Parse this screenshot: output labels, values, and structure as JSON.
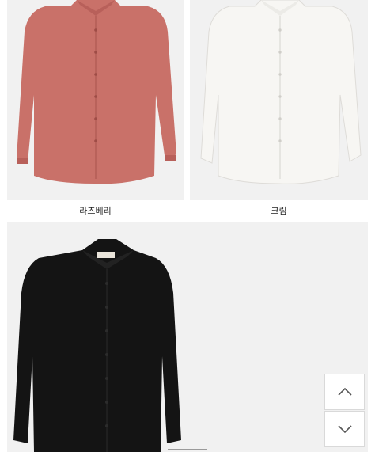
{
  "products": [
    {
      "caption": "라즈베리",
      "shirt_color": "#c97169"
    },
    {
      "caption": "크림",
      "shirt_color": "#f7f6f3"
    },
    {
      "caption": "",
      "shirt_color": "#141414"
    }
  ],
  "navigation": {
    "scroll_top_icon": "chevron-up-icon",
    "scroll_down_icon": "chevron-down-icon"
  },
  "colors": {
    "tile_background": "#f1f1f1",
    "button_border": "#d9d9d9",
    "icon_stroke": "#555555"
  }
}
